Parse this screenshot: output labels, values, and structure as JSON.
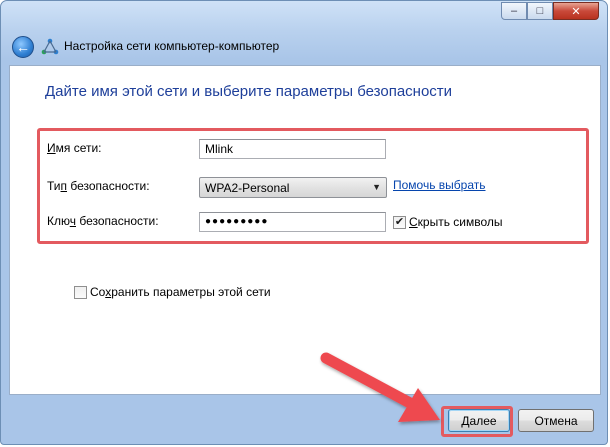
{
  "window": {
    "title": "Настройка сети компьютер-компьютер",
    "controls": {
      "minimize": "–",
      "maximize": "□",
      "close": "✕"
    },
    "back_icon": "back-arrow-icon",
    "app_icon": "network-icon"
  },
  "page": {
    "heading": "Дайте имя этой сети и выберите параметры безопасности"
  },
  "form": {
    "network_name": {
      "label_pre": "",
      "label_underlined": "И",
      "label_post": "мя сети:",
      "value": "Mlink"
    },
    "security_type": {
      "label_pre": "Ти",
      "label_underlined": "п",
      "label_post": " безопасности:",
      "value": "WPA2-Personal",
      "help_link": "Помочь выбрать"
    },
    "security_key": {
      "label_pre": "Клю",
      "label_underlined": "ч",
      "label_post": " безопасности:",
      "value": "●●●●●●●●●",
      "hide_chars_label_pre": "",
      "hide_chars_underlined": "С",
      "hide_chars_label_post": "крыть символы",
      "hide_chars_checked": true
    },
    "save_settings": {
      "label_pre": "Со",
      "label_underlined": "х",
      "label_post": "ранить параметры этой сети",
      "checked": false
    }
  },
  "footer": {
    "next_label_underlined": "Д",
    "next_label_post": "алее",
    "cancel_label": "Отмена"
  },
  "colors": {
    "highlight": "#e35a5f",
    "heading": "#1e3f9a",
    "link": "#0645ad"
  }
}
